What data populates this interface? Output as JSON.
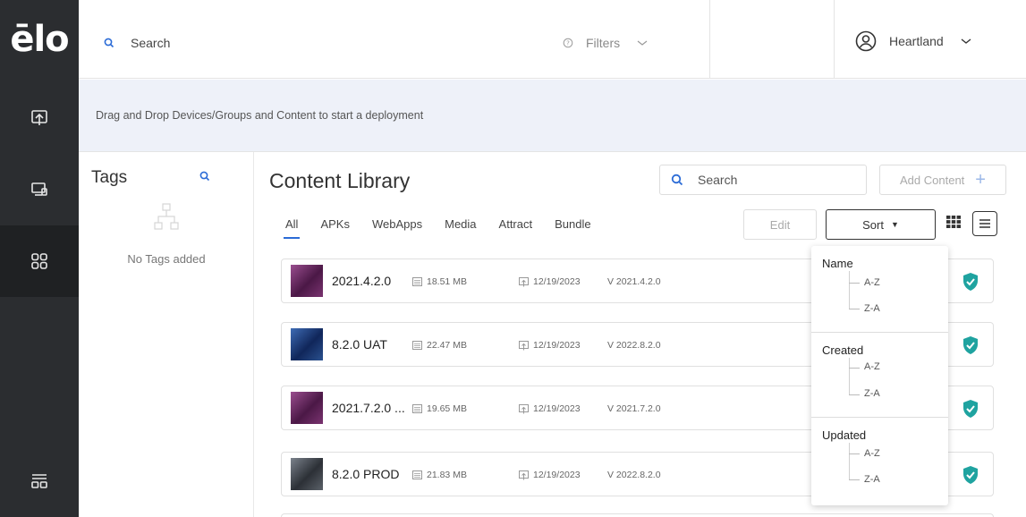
{
  "brand": {
    "logo_text": "ēlo"
  },
  "rail": {
    "items": [
      "deploy-icon",
      "devices-icon",
      "content-icon",
      "settings-icon"
    ],
    "active": "content-icon"
  },
  "topbar": {
    "search_placeholder": "Search",
    "filters_label": "Filters",
    "user_name": "Heartland"
  },
  "banner": {
    "text": "Drag and Drop Devices/Groups and Content to start a deployment"
  },
  "tags": {
    "title": "Tags",
    "empty_text": "No Tags added"
  },
  "library": {
    "title": "Content Library",
    "search_placeholder": "Search",
    "add_label": "Add Content",
    "tabs": [
      "All",
      "APKs",
      "WebApps",
      "Media",
      "Attract",
      "Bundle"
    ],
    "active_tab": "All",
    "edit_label": "Edit",
    "sort_label": "Sort",
    "rows": [
      {
        "name": "2021.4.2.0",
        "size": "18.51 MB",
        "date": "12/19/2023",
        "version": "V 2021.4.2.0",
        "thumb_color": "#6d2a66"
      },
      {
        "name": "8.2.0 UAT",
        "size": "22.47 MB",
        "date": "12/19/2023",
        "version": "V 2022.8.2.0",
        "thumb_color": "#1d3d77"
      },
      {
        "name": "2021.7.2.0 ...",
        "size": "19.65 MB",
        "date": "12/19/2023",
        "version": "V 2021.7.2.0",
        "thumb_color": "#6d2a66"
      },
      {
        "name": "8.2.0 PROD",
        "size": "21.83 MB",
        "date": "12/19/2023",
        "version": "V 2022.8.2.0",
        "thumb_color": "#4a4f57"
      }
    ]
  },
  "sort_menu": {
    "groups": [
      {
        "label": "Name",
        "options": [
          "A-Z",
          "Z-A"
        ]
      },
      {
        "label": "Created",
        "options": [
          "A-Z",
          "Z-A"
        ]
      },
      {
        "label": "Updated",
        "options": [
          "A-Z",
          "Z-A"
        ]
      }
    ]
  },
  "colors": {
    "accent": "#2b6bd6",
    "rail": "#2b2d30",
    "banner": "#eef1f9",
    "shield": "#1fa3a0"
  }
}
